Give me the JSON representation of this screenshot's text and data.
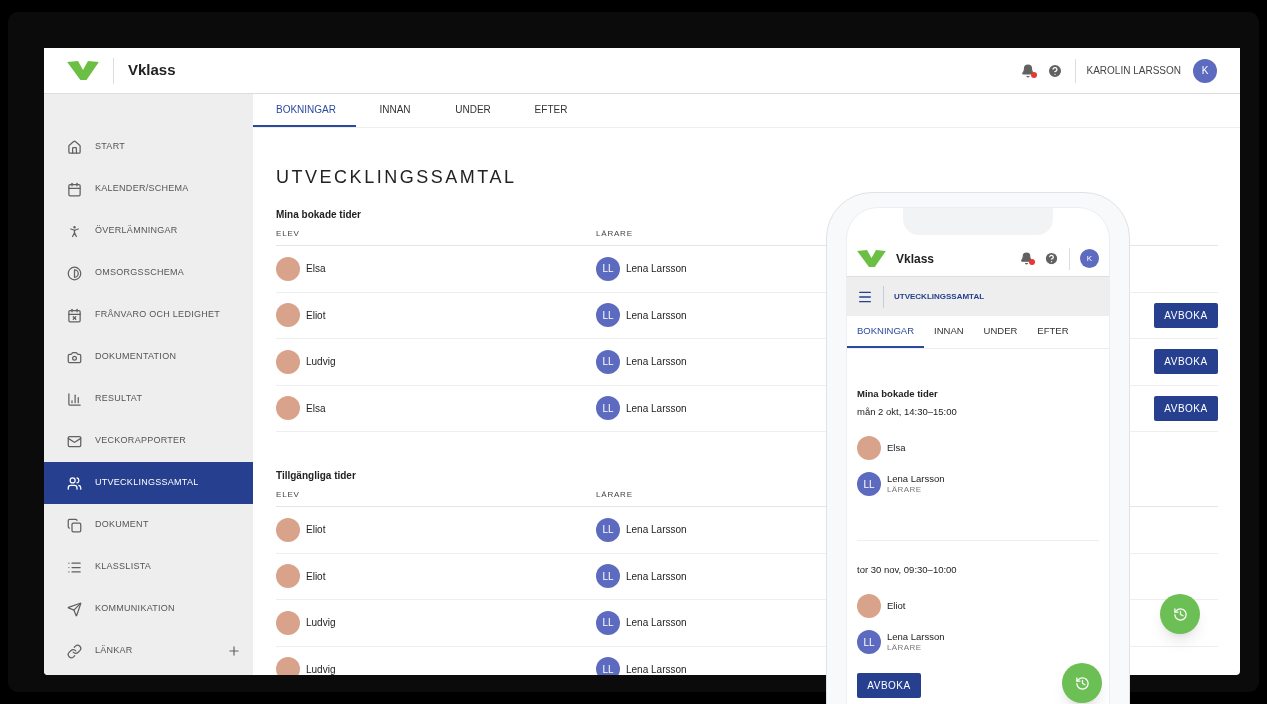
{
  "header": {
    "brand": "Vklass",
    "user_name": "KAROLIN LARSSON",
    "user_initial": "K",
    "has_notification": true
  },
  "sidebar": {
    "items": [
      {
        "label": "START",
        "selected": false,
        "addable": false
      },
      {
        "label": "KALENDER/SCHEMA",
        "selected": false,
        "addable": false
      },
      {
        "label": "ÖVERLÄMNINGAR",
        "selected": false,
        "addable": false
      },
      {
        "label": "OMSORGSSCHEMA",
        "selected": false,
        "addable": false
      },
      {
        "label": "FRÅNVARO OCH LEDIGHET",
        "selected": false,
        "addable": false
      },
      {
        "label": "DOKUMENTATION",
        "selected": false,
        "addable": false
      },
      {
        "label": "RESULTAT",
        "selected": false,
        "addable": false
      },
      {
        "label": "VECKORAPPORTER",
        "selected": false,
        "addable": false
      },
      {
        "label": "UTVECKLINGSSAMTAL",
        "selected": true,
        "addable": false
      },
      {
        "label": "DOKUMENT",
        "selected": false,
        "addable": false
      },
      {
        "label": "KLASSLISTA",
        "selected": false,
        "addable": false
      },
      {
        "label": "KOMMUNIKATION",
        "selected": false,
        "addable": false
      },
      {
        "label": "LÄNKAR",
        "selected": false,
        "addable": true
      }
    ]
  },
  "tabs": [
    {
      "label": "BOKNINGAR",
      "selected": true
    },
    {
      "label": "INNAN",
      "selected": false
    },
    {
      "label": "UNDER",
      "selected": false
    },
    {
      "label": "EFTER",
      "selected": false
    }
  ],
  "page_title": "UTVECKLINGSSAMTAL",
  "sections": [
    {
      "title": "Mina bokade tider",
      "columns": [
        "ELEV",
        "LÄRARE"
      ],
      "rows": [
        {
          "student": "Elsa",
          "teacher_initials": "LL",
          "teacher": "Lena Larsson"
        },
        {
          "student": "Eliot",
          "teacher_initials": "LL",
          "teacher": "Lena Larsson",
          "button": "AVBOKA"
        },
        {
          "student": "Ludvig",
          "teacher_initials": "LL",
          "teacher": "Lena Larsson",
          "button": "AVBOKA"
        },
        {
          "student": "Elsa",
          "teacher_initials": "LL",
          "teacher": "Lena Larsson",
          "button": "AVBOKA"
        }
      ]
    },
    {
      "title": "Tillgängliga tider",
      "columns": [
        "ELEV",
        "LÄRARE"
      ],
      "rows": [
        {
          "student": "Eliot",
          "teacher_initials": "LL",
          "teacher": "Lena Larsson"
        },
        {
          "student": "Eliot",
          "teacher_initials": "LL",
          "teacher": "Lena Larsson"
        },
        {
          "student": "Ludvig",
          "teacher_initials": "LL",
          "teacher": "Lena Larsson"
        },
        {
          "student": "Ludvig",
          "teacher_initials": "LL",
          "teacher": "Lena Larsson"
        }
      ]
    }
  ],
  "phone": {
    "brand": "Vklass",
    "user_initial": "K",
    "has_notification": true,
    "page_title": "UTVECKLINGSSAMTAL",
    "tabs": [
      {
        "label": "BOKNINGAR",
        "selected": true
      },
      {
        "label": "INNAN",
        "selected": false
      },
      {
        "label": "UNDER",
        "selected": false
      },
      {
        "label": "EFTER",
        "selected": false
      }
    ],
    "section_title": "Mina bokade tider",
    "bookings": [
      {
        "date": "mån 2 okt, 14:30–15:00",
        "student": "Elsa",
        "teacher_initials": "LL",
        "teacher": "Lena Larsson",
        "teacher_role": "LÄRARE"
      },
      {
        "date": "tor 30 nov, 09:30–10:00",
        "student": "Eliot",
        "teacher_initials": "LL",
        "teacher": "Lena Larsson",
        "teacher_role": "LÄRARE",
        "button": "AVBOKA"
      }
    ]
  }
}
